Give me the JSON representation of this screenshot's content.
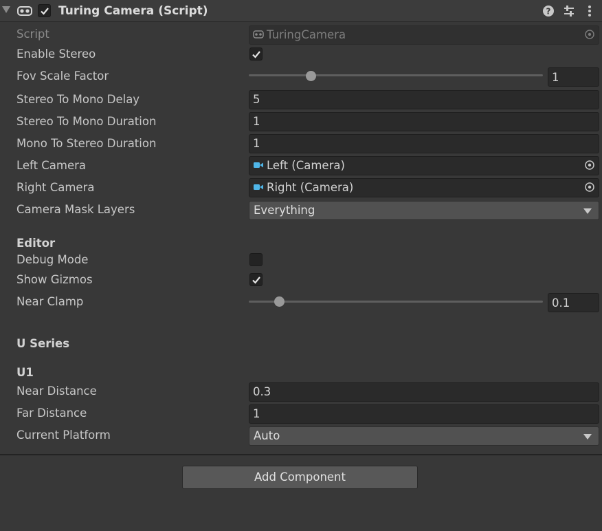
{
  "component": {
    "title": "Turing Camera (Script)",
    "enabled": true,
    "icon": "vr-headset-icon"
  },
  "header_buttons": [
    "help-icon",
    "presets-icon",
    "kebab-menu-icon"
  ],
  "fields": {
    "script": {
      "label": "Script",
      "value": "TuringCamera"
    },
    "enable_stereo": {
      "label": "Enable Stereo",
      "checked": true
    },
    "fov_scale_factor": {
      "label": "Fov Scale Factor",
      "value": "1",
      "slider_fraction": 0.21
    },
    "stereo_to_mono_delay": {
      "label": "Stereo To Mono Delay",
      "value": "5"
    },
    "stereo_to_mono_duration": {
      "label": "Stereo To Mono Duration",
      "value": "1"
    },
    "mono_to_stereo_duration": {
      "label": "Mono To Stereo Duration",
      "value": "1"
    },
    "left_camera": {
      "label": "Left Camera",
      "value": "Left (Camera)"
    },
    "right_camera": {
      "label": "Right Camera",
      "value": "Right (Camera)"
    },
    "camera_mask_layers": {
      "label": "Camera Mask Layers",
      "value": "Everything"
    }
  },
  "editor": {
    "heading": "Editor",
    "debug_mode": {
      "label": "Debug Mode",
      "checked": false
    },
    "show_gizmos": {
      "label": "Show Gizmos",
      "checked": true
    },
    "near_clamp": {
      "label": "Near Clamp",
      "value": "0.1",
      "slider_fraction": 0.1
    }
  },
  "u_series": {
    "heading": "U Series",
    "u1": {
      "heading": "U1",
      "near_distance": {
        "label": "Near Distance",
        "value": "0.3"
      },
      "far_distance": {
        "label": "Far Distance",
        "value": "1"
      },
      "current_platform": {
        "label": "Current Platform",
        "value": "Auto"
      }
    }
  },
  "add_component_label": "Add Component",
  "colors": {
    "background": "#383838",
    "field": "#2a2a2a",
    "camera_icon": "#4fb6e8"
  }
}
